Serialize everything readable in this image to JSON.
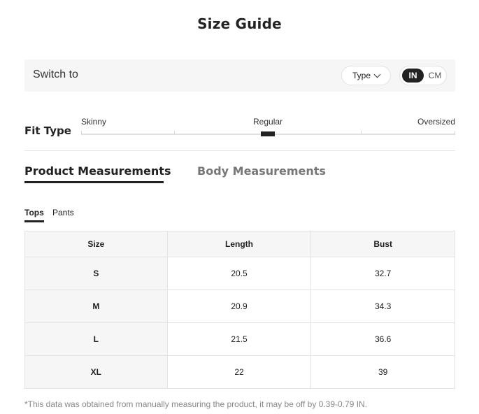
{
  "title": "Size Guide",
  "switch_bar": {
    "label": "Switch to",
    "type_button": "Type",
    "units": [
      "IN",
      "CM"
    ],
    "selected_unit": "IN"
  },
  "fit_type": {
    "label": "Fit Type",
    "options": [
      "Skinny",
      "Regular",
      "Oversized"
    ],
    "selected": "Regular"
  },
  "measurement_tabs": [
    "Product Measurements",
    "Body Measurements"
  ],
  "active_measurement_tab": "Product Measurements",
  "category_tabs": [
    "Tops",
    "Pants"
  ],
  "active_category_tab": "Tops",
  "table": {
    "headers": [
      "Size",
      "Length",
      "Bust"
    ],
    "rows": [
      [
        "S",
        "20.5",
        "32.7"
      ],
      [
        "M",
        "20.9",
        "34.3"
      ],
      [
        "L",
        "21.5",
        "36.6"
      ],
      [
        "XL",
        "22",
        "39"
      ]
    ]
  },
  "footnote": "*This data was obtained from manually measuring the product, it may be off by 0.39-0.79 IN."
}
